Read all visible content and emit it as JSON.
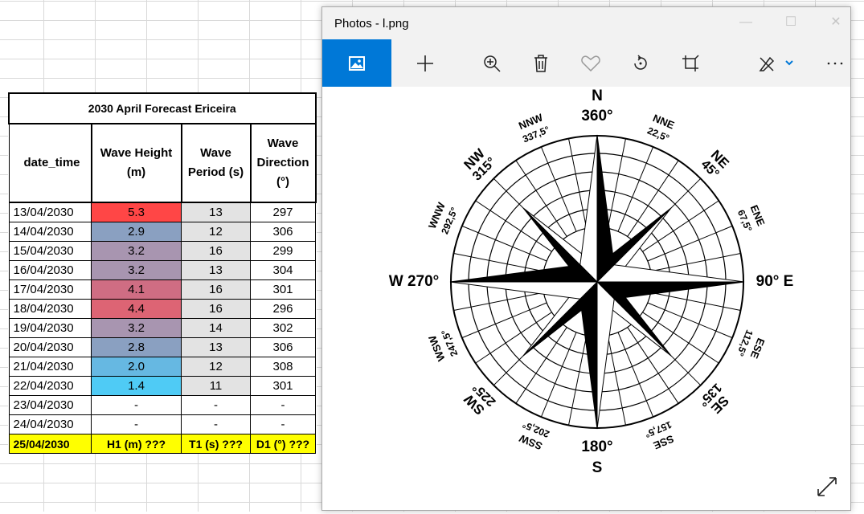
{
  "table": {
    "title": "2030 April Forecast Ericeira",
    "headers": {
      "date": "date_time",
      "height_1": "Wave Height",
      "height_2": "(m)",
      "period_1": "Wave",
      "period_2": "Period (s)",
      "dir_1": "Wave",
      "dir_2": "Direction",
      "dir_3": "(°)"
    },
    "rows": [
      {
        "date": "13/04/2030",
        "height": "5.3",
        "period": "13",
        "direction": "297",
        "color": "#ff4646"
      },
      {
        "date": "14/04/2030",
        "height": "2.9",
        "period": "12",
        "direction": "306",
        "color": "#8aa0c1"
      },
      {
        "date": "15/04/2030",
        "height": "3.2",
        "period": "16",
        "direction": "299",
        "color": "#a895b0"
      },
      {
        "date": "16/04/2030",
        "height": "3.2",
        "period": "13",
        "direction": "304",
        "color": "#a895b0"
      },
      {
        "date": "17/04/2030",
        "height": "4.1",
        "period": "16",
        "direction": "301",
        "color": "#cf6d83"
      },
      {
        "date": "18/04/2030",
        "height": "4.4",
        "period": "16",
        "direction": "296",
        "color": "#dd6474"
      },
      {
        "date": "19/04/2030",
        "height": "3.2",
        "period": "14",
        "direction": "302",
        "color": "#a895b0"
      },
      {
        "date": "20/04/2030",
        "height": "2.8",
        "period": "13",
        "direction": "306",
        "color": "#8aa0c1"
      },
      {
        "date": "21/04/2030",
        "height": "2.0",
        "period": "12",
        "direction": "308",
        "color": "#66b8e2"
      },
      {
        "date": "22/04/2030",
        "height": "1.4",
        "period": "11",
        "direction": "301",
        "color": "#4fcbf5"
      },
      {
        "date": "23/04/2030",
        "height": "-",
        "period": "-",
        "direction": "-",
        "color": "#ffffff"
      },
      {
        "date": "24/04/2030",
        "height": "-",
        "period": "-",
        "direction": "-",
        "color": "#ffffff"
      }
    ],
    "last_row": {
      "date": "25/04/2030",
      "height": "H1 (m) ???",
      "period": "T1 (s) ???",
      "direction": "D1 (°) ???"
    }
  },
  "photos": {
    "title": "Photos - l.png",
    "controls": {
      "minimize": "—",
      "maximize": "☐",
      "close": "✕"
    },
    "toolbar_icons": [
      "image-icon",
      "add-icon",
      "zoom-in-icon",
      "delete-icon",
      "favorite-icon",
      "rotate-icon",
      "crop-icon",
      "edit-icon",
      "more-icon"
    ],
    "compass": {
      "N": "N",
      "N_deg": "360°",
      "S": "S",
      "S_deg": "180°",
      "W": "W 270°",
      "E": "90° E",
      "NE": "NE",
      "NE_deg": "45°",
      "NW": "NW",
      "NW_deg": "315°",
      "SE": "SE",
      "SE_deg": "135°",
      "SW": "SW",
      "SW_deg": "225°",
      "NNE": "NNE",
      "NNE_deg": "22,5°",
      "NNW": "NNW",
      "NNW_deg": "337,5°",
      "ENE": "ENE",
      "ENE_deg": "67,5°",
      "WNW": "WNW",
      "WNW_deg": "292,5°",
      "ESE": "ESE",
      "ESE_deg": "112,5°",
      "WSW": "WSW",
      "WSW_deg": "247,5°",
      "SSE": "SSE",
      "SSE_deg": "157,5°",
      "SSW": "SSW",
      "SSW_deg": "202,5°"
    }
  }
}
